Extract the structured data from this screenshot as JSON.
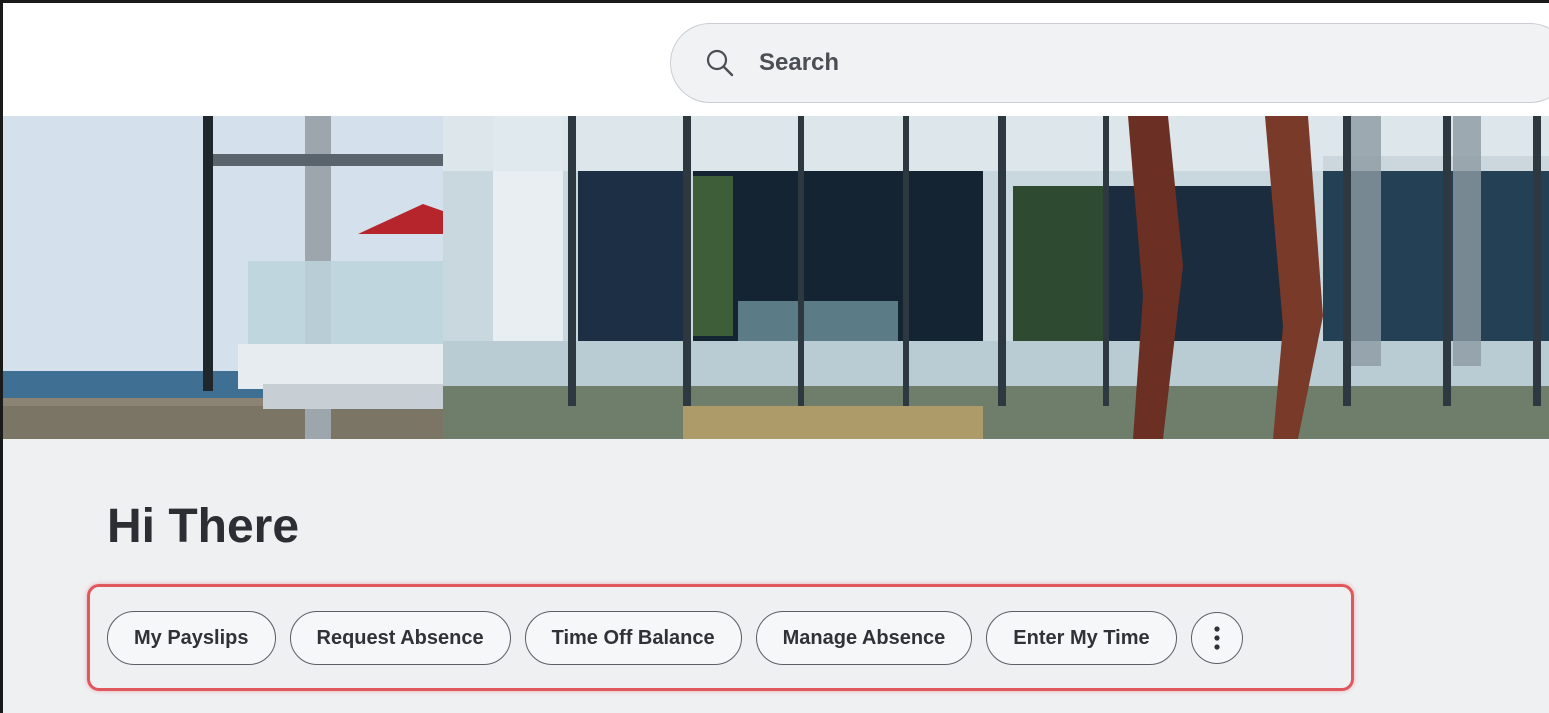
{
  "search": {
    "placeholder": "Search",
    "icon": "search-icon"
  },
  "hero": {
    "description_icon": "building-banner-image"
  },
  "greeting": "Hi There",
  "quick_actions": [
    {
      "label": "My Payslips"
    },
    {
      "label": "Request Absence"
    },
    {
      "label": "Time Off Balance"
    },
    {
      "label": "Manage Absence"
    },
    {
      "label": "Enter My Time"
    }
  ],
  "more_menu": {
    "icon": "more-vertical-icon"
  },
  "colors": {
    "highlight": "#e0585e",
    "background": "#eff0f2",
    "text": "#2b2e33"
  }
}
